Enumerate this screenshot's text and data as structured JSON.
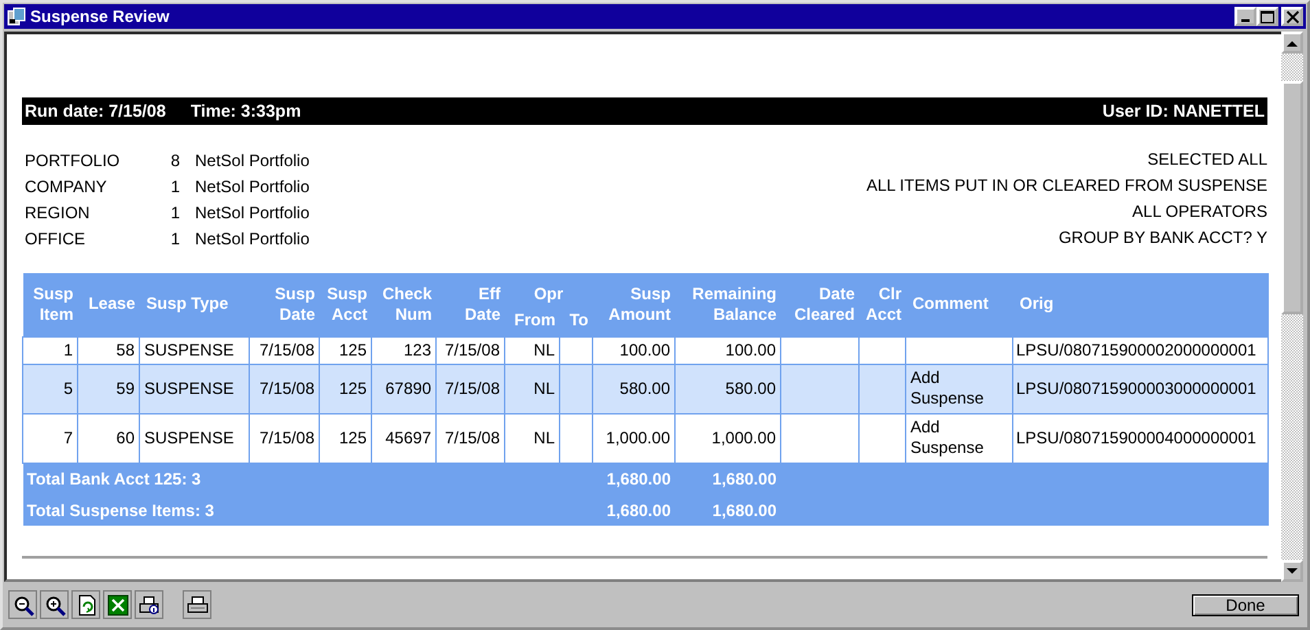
{
  "window": {
    "title": "Suspense Review",
    "controls": [
      {
        "kind": "minimize"
      },
      {
        "kind": "maximize"
      },
      {
        "kind": "close"
      }
    ]
  },
  "report": {
    "header_bar": {
      "run_date": "Run date: 7/15/08",
      "time": "Time: 3:33pm",
      "user_id": "User ID: NANETTEL"
    },
    "filters": [
      {
        "label": "PORTFOLIO",
        "code": "8",
        "name": "NetSol Portfolio"
      },
      {
        "label": "COMPANY",
        "code": "1",
        "name": "NetSol Portfolio"
      },
      {
        "label": "REGION",
        "code": "1",
        "name": "NetSol Portfolio"
      },
      {
        "label": "OFFICE",
        "code": "1",
        "name": "NetSol Portfolio"
      }
    ],
    "criteria": [
      "SELECTED ALL",
      "ALL ITEMS PUT IN OR CLEARED FROM SUSPENSE",
      "ALL OPERATORS",
      "GROUP BY BANK ACCT? Y"
    ],
    "table": {
      "column_groups": [
        {
          "label": "Opr"
        }
      ],
      "columns": [
        {
          "label": "Susp\nItem"
        },
        {
          "label": "Lease"
        },
        {
          "label": "Susp Type"
        },
        {
          "label": "Susp\nDate"
        },
        {
          "label": "Susp\nAcct"
        },
        {
          "label": "Check\nNum"
        },
        {
          "label": "Eff\nDate"
        },
        {
          "label": "From"
        },
        {
          "label": "To"
        },
        {
          "label": "Susp\nAmount"
        },
        {
          "label": "Remaining\nBalance"
        },
        {
          "label": "Date\nCleared"
        },
        {
          "label": "Clr\nAcct"
        },
        {
          "label": "Comment"
        },
        {
          "label": "Orig"
        }
      ],
      "rows": [
        {
          "shaded": false,
          "cells": [
            "1",
            "58",
            "SUSPENSE",
            "7/15/08",
            "125",
            "123",
            "7/15/08",
            "NL",
            "",
            "100.00",
            "100.00",
            "",
            "",
            "",
            "LPSU/080715900002000000001"
          ]
        },
        {
          "shaded": true,
          "cells": [
            "5",
            "59",
            "SUSPENSE",
            "7/15/08",
            "125",
            "67890",
            "7/15/08",
            "NL",
            "",
            "580.00",
            "580.00",
            "",
            "",
            "Add Suspense",
            "LPSU/080715900003000000001"
          ]
        },
        {
          "shaded": false,
          "cells": [
            "7",
            "60",
            "SUSPENSE",
            "7/15/08",
            "125",
            "45697",
            "7/15/08",
            "NL",
            "",
            "1,000.00",
            "1,000.00",
            "",
            "",
            "Add Suspense",
            "LPSU/080715900004000000001"
          ]
        }
      ],
      "totals": [
        {
          "label": "Total Bank Acct 125: 3",
          "susp_amount": "1,680.00",
          "remaining_balance": "1,680.00"
        },
        {
          "label": "Total Suspense Items: 3",
          "susp_amount": "1,680.00",
          "remaining_balance": "1,680.00"
        }
      ]
    }
  },
  "toolbar": {
    "tools": [
      {
        "kind": "zoom_out"
      },
      {
        "kind": "zoom_in"
      },
      {
        "kind": "refresh"
      },
      {
        "kind": "excel"
      },
      {
        "kind": "print_info"
      },
      {
        "kind": "print"
      }
    ],
    "done_button": "Done"
  }
}
